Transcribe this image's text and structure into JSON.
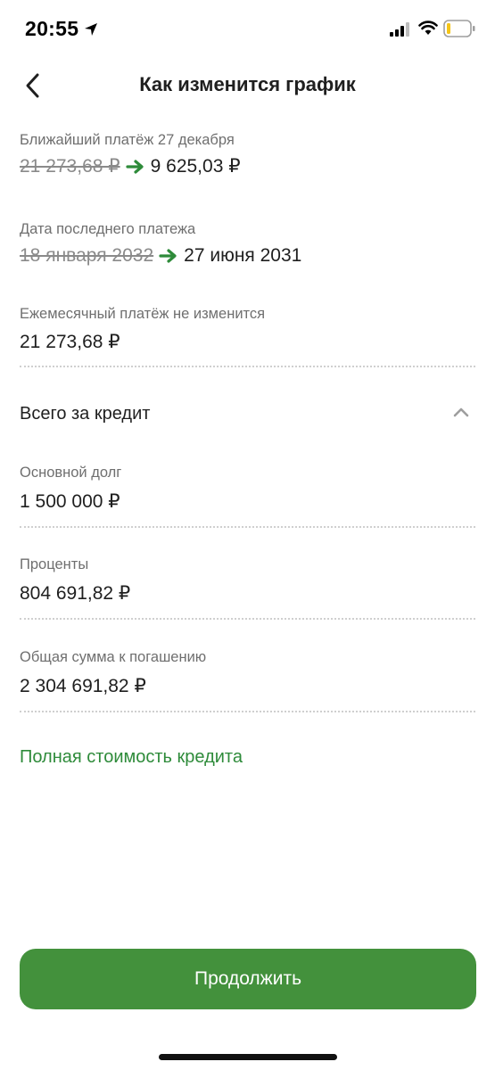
{
  "status_bar": {
    "time": "20:55"
  },
  "nav": {
    "title": "Как изменится график"
  },
  "next_payment": {
    "label": "Ближайший платёж 27 декабря",
    "old_value": "21 273,68 ₽",
    "new_value": "9 625,03 ₽"
  },
  "last_payment": {
    "label": "Дата последнего платежа",
    "old_value": "18 января 2032",
    "new_value": "27 июня 2031"
  },
  "monthly": {
    "label": "Ежемесячный платёж не изменится",
    "value": "21 273,68 ₽"
  },
  "total_section": {
    "title": "Всего за кредит",
    "expanded": true,
    "items": [
      {
        "label": "Основной долг",
        "value": "1 500 000 ₽"
      },
      {
        "label": "Проценты",
        "value": "804 691,82 ₽"
      },
      {
        "label": "Общая сумма к погашению",
        "value": "2 304 691,82 ₽"
      }
    ]
  },
  "full_cost_link": "Полная стоимость кредита",
  "continue_button": "Продолжить",
  "colors": {
    "accent": "#43913c",
    "link": "#2e8b3a",
    "arrow": "#2e8b3a"
  }
}
